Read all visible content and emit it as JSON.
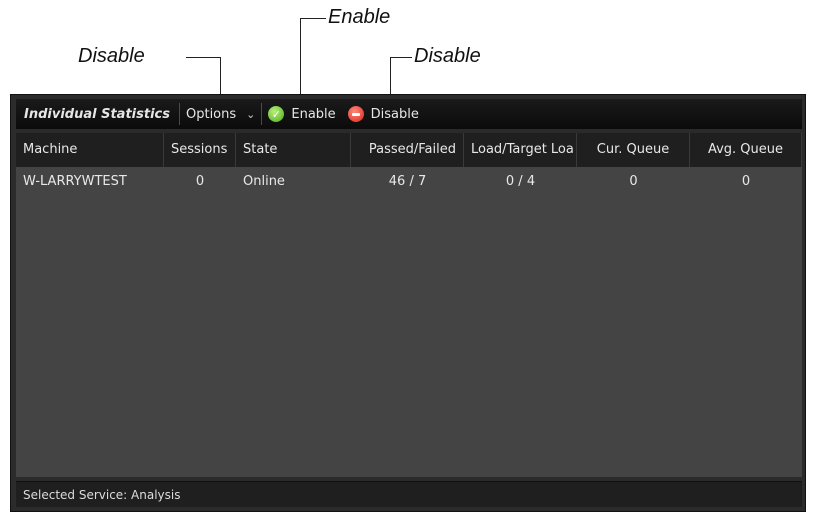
{
  "callouts": {
    "enable_label": "Enable",
    "disable_left_label": "Disable",
    "disable_right_label": "Disable"
  },
  "toolbar": {
    "title": "Individual Statistics",
    "options_label": "Options",
    "enable_label": "Enable",
    "disable_label": "Disable"
  },
  "table": {
    "headers": {
      "machine": "Machine",
      "sessions": "Sessions",
      "state": "State",
      "passed_failed": "Passed/Failed",
      "load_target": "Load/Target Loa",
      "cur_queue": "Cur. Queue",
      "avg_queue": "Avg. Queue"
    },
    "rows": [
      {
        "machine": "W-LARRYWTEST",
        "sessions": "0",
        "state": "Online",
        "passed_failed": "46 / 7",
        "load_target": "0 / 4",
        "cur_queue": "0",
        "avg_queue": "0"
      }
    ]
  },
  "status": {
    "text": "Selected Service: Analysis"
  },
  "icons": {
    "enable": "check-circle-icon",
    "disable": "minus-circle-icon",
    "options": "chevron-down-icon"
  },
  "colors": {
    "window_bg": "#2b2b2b",
    "toolbar_bg": "#0b0b0b",
    "table_bg": "#444444",
    "enable_icon": "#4aa91a",
    "disable_icon": "#d7261b"
  }
}
